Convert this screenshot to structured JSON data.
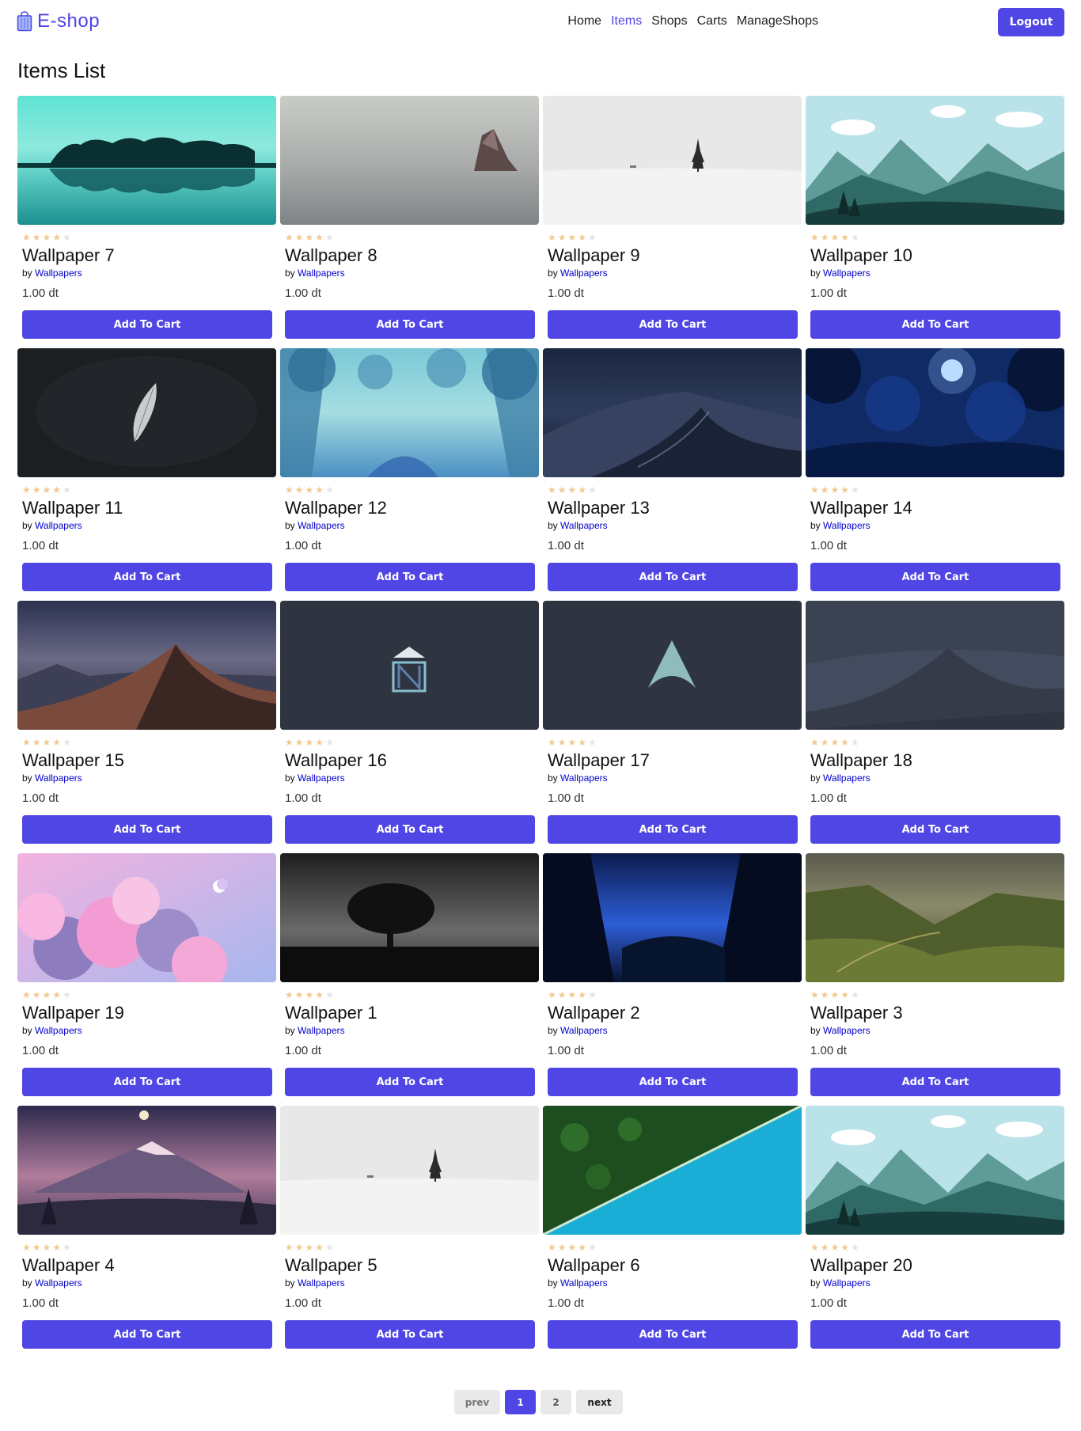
{
  "nav": {
    "brand": "E-shop",
    "links": [
      {
        "label": "Home",
        "active": false
      },
      {
        "label": "Items",
        "active": true
      },
      {
        "label": "Shops",
        "active": false
      },
      {
        "label": "Carts",
        "active": false
      },
      {
        "label": "ManageShops",
        "active": false
      }
    ],
    "logout_label": "Logout"
  },
  "page_title": "Items List",
  "colors": {
    "accent": "#4f46e5",
    "star_on": "#f2c98f",
    "star_off": "#e4e4e4",
    "shop_link": "#0000cc"
  },
  "items": [
    {
      "name": "Wallpaper 7",
      "by": "by",
      "shop": "Wallpapers",
      "price": "1.00 dt",
      "rating": 4,
      "max_rating": 5,
      "button": "Add To Cart",
      "image": "teal-lake-trees"
    },
    {
      "name": "Wallpaper 8",
      "by": "by",
      "shop": "Wallpapers",
      "price": "1.00 dt",
      "rating": 4,
      "max_rating": 5,
      "button": "Add To Cart",
      "image": "sea-rock"
    },
    {
      "name": "Wallpaper 9",
      "by": "by",
      "shop": "Wallpapers",
      "price": "1.00 dt",
      "rating": 4,
      "max_rating": 5,
      "button": "Add To Cart",
      "image": "lone-tree-white"
    },
    {
      "name": "Wallpaper 10",
      "by": "by",
      "shop": "Wallpapers",
      "price": "1.00 dt",
      "rating": 4,
      "max_rating": 5,
      "button": "Add To Cart",
      "image": "flat-mountains"
    },
    {
      "name": "Wallpaper 11",
      "by": "by",
      "shop": "Wallpapers",
      "price": "1.00 dt",
      "rating": 4,
      "max_rating": 5,
      "button": "Add To Cart",
      "image": "feather-dark"
    },
    {
      "name": "Wallpaper 12",
      "by": "by",
      "shop": "Wallpapers",
      "price": "1.00 dt",
      "rating": 4,
      "max_rating": 5,
      "button": "Add To Cart",
      "image": "blue-forest"
    },
    {
      "name": "Wallpaper 13",
      "by": "by",
      "shop": "Wallpapers",
      "price": "1.00 dt",
      "rating": 4,
      "max_rating": 5,
      "button": "Add To Cart",
      "image": "night-dunes"
    },
    {
      "name": "Wallpaper 14",
      "by": "by",
      "shop": "Wallpapers",
      "price": "1.00 dt",
      "rating": 4,
      "max_rating": 5,
      "button": "Add To Cart",
      "image": "moon-forest"
    },
    {
      "name": "Wallpaper 15",
      "by": "by",
      "shop": "Wallpapers",
      "price": "1.00 dt",
      "rating": 4,
      "max_rating": 5,
      "button": "Add To Cart",
      "image": "dusk-dunes"
    },
    {
      "name": "Wallpaper 16",
      "by": "by",
      "shop": "Wallpapers",
      "price": "1.00 dt",
      "rating": 4,
      "max_rating": 5,
      "button": "Add To Cart",
      "image": "logo-n-dark"
    },
    {
      "name": "Wallpaper 17",
      "by": "by",
      "shop": "Wallpapers",
      "price": "1.00 dt",
      "rating": 4,
      "max_rating": 5,
      "button": "Add To Cart",
      "image": "logo-arch-dark"
    },
    {
      "name": "Wallpaper 18",
      "by": "by",
      "shop": "Wallpapers",
      "price": "1.00 dt",
      "rating": 4,
      "max_rating": 5,
      "button": "Add To Cart",
      "image": "grey-dunes"
    },
    {
      "name": "Wallpaper 19",
      "by": "by",
      "shop": "Wallpapers",
      "price": "1.00 dt",
      "rating": 4,
      "max_rating": 5,
      "button": "Add To Cart",
      "image": "pink-clouds"
    },
    {
      "name": "Wallpaper 1",
      "by": "by",
      "shop": "Wallpapers",
      "price": "1.00 dt",
      "rating": 4,
      "max_rating": 5,
      "button": "Add To Cart",
      "image": "tree-silhouette"
    },
    {
      "name": "Wallpaper 2",
      "by": "by",
      "shop": "Wallpapers",
      "price": "1.00 dt",
      "rating": 4,
      "max_rating": 5,
      "button": "Add To Cart",
      "image": "blue-valley"
    },
    {
      "name": "Wallpaper 3",
      "by": "by",
      "shop": "Wallpapers",
      "price": "1.00 dt",
      "rating": 4,
      "max_rating": 5,
      "button": "Add To Cart",
      "image": "green-valley"
    },
    {
      "name": "Wallpaper 4",
      "by": "by",
      "shop": "Wallpapers",
      "price": "1.00 dt",
      "rating": 4,
      "max_rating": 5,
      "button": "Add To Cart",
      "image": "purple-mountain"
    },
    {
      "name": "Wallpaper 5",
      "by": "by",
      "shop": "Wallpapers",
      "price": "1.00 dt",
      "rating": 4,
      "max_rating": 5,
      "button": "Add To Cart",
      "image": "lone-tree-white"
    },
    {
      "name": "Wallpaper 6",
      "by": "by",
      "shop": "Wallpapers",
      "price": "1.00 dt",
      "rating": 4,
      "max_rating": 5,
      "button": "Add To Cart",
      "image": "forest-lake-aerial"
    },
    {
      "name": "Wallpaper 20",
      "by": "by",
      "shop": "Wallpapers",
      "price": "1.00 dt",
      "rating": 4,
      "max_rating": 5,
      "button": "Add To Cart",
      "image": "flat-mountains"
    }
  ],
  "pagination": {
    "prev_label": "prev",
    "pages": [
      "1",
      "2"
    ],
    "current": "1",
    "next_label": "next"
  }
}
